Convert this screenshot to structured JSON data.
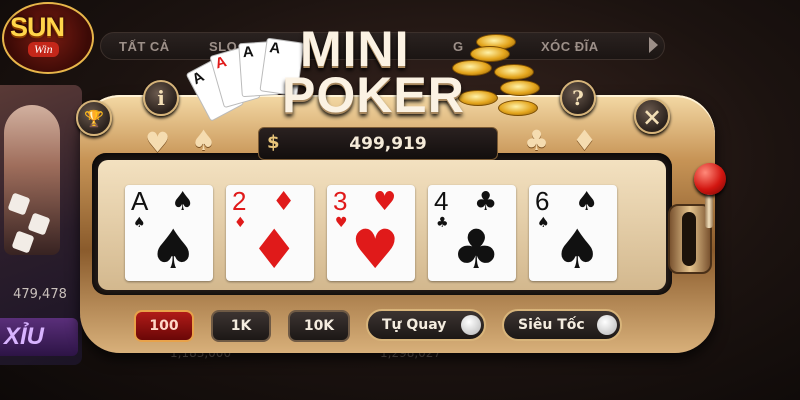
{
  "brand": {
    "logo_text": "SUN",
    "logo_sub": "Win"
  },
  "lobby": {
    "tabs": [
      "TẤT CẢ",
      "SLO",
      "G",
      "XÓC ĐĨA"
    ],
    "side_game": {
      "amount": "479,478",
      "label": "XỈU"
    },
    "ghost_amounts": [
      "1,183,000",
      "1,298,027"
    ]
  },
  "game": {
    "title_line1": "MINI",
    "title_line2": "POKER",
    "balance_symbol": "$",
    "balance": "499,919",
    "cards": [
      {
        "rank": "A",
        "suit": "♠",
        "color": "black"
      },
      {
        "rank": "2",
        "suit": "♦",
        "color": "red"
      },
      {
        "rank": "3",
        "suit": "♥",
        "color": "red"
      },
      {
        "rank": "4",
        "suit": "♣",
        "color": "black"
      },
      {
        "rank": "6",
        "suit": "♠",
        "color": "black"
      }
    ],
    "bets": [
      {
        "label": "100",
        "active": true
      },
      {
        "label": "1K",
        "active": false
      },
      {
        "label": "10K",
        "active": false
      }
    ],
    "toggles": [
      {
        "label": "Tự Quay",
        "on": false
      },
      {
        "label": "Siêu Tốc",
        "on": false
      }
    ],
    "buttons": {
      "info": "i",
      "help": "?",
      "close": "×"
    },
    "decor_suits_left": [
      "♥",
      "♠"
    ],
    "decor_suits_right": [
      "♣",
      "♦"
    ]
  },
  "colors": {
    "accent_gold": "#d8b47a",
    "active_bet": "#b01b18",
    "lever_ball": "#d21610"
  },
  "icons": [
    "trophy-icon",
    "info-icon",
    "help-icon",
    "close-icon",
    "dollar-icon",
    "lever-icon"
  ]
}
